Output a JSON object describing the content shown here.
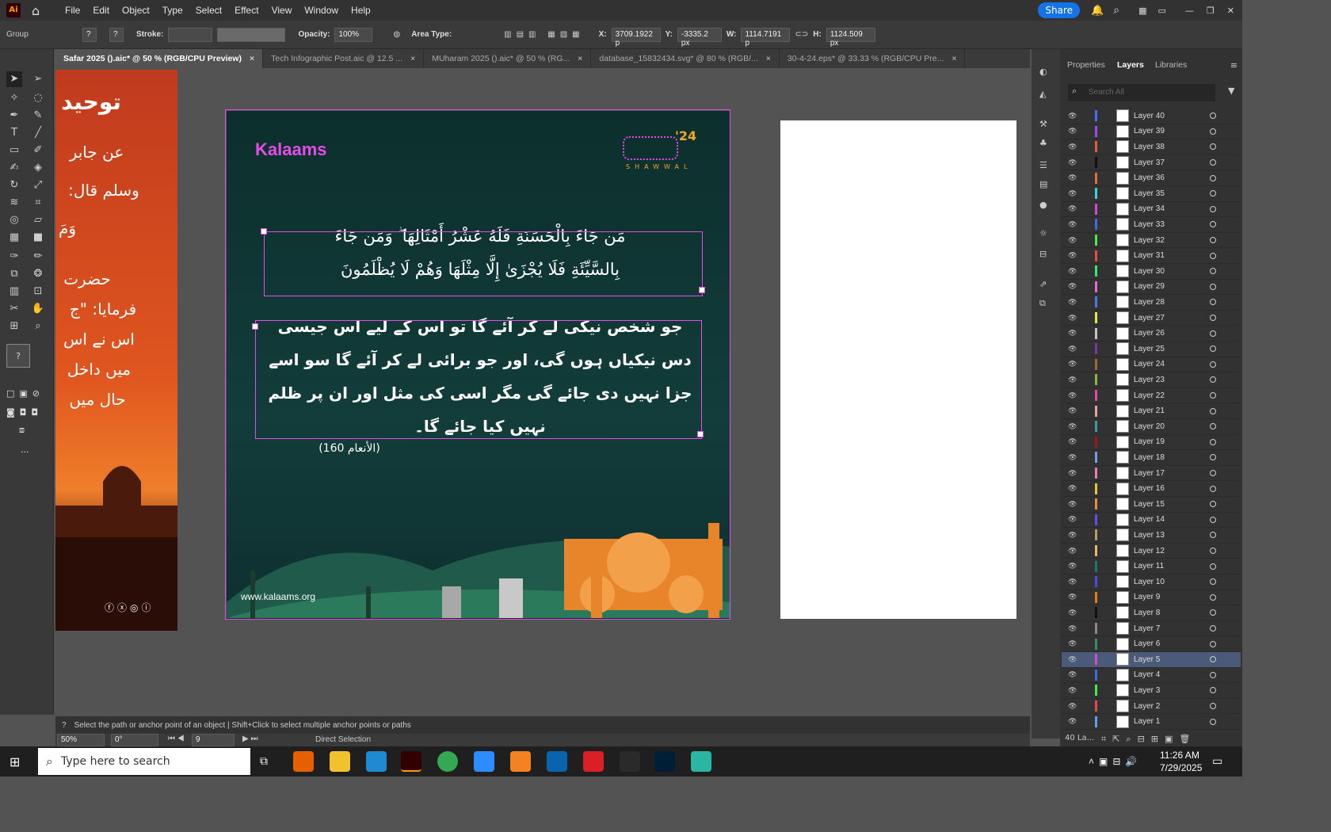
{
  "app": {
    "logo": "Ai",
    "share_label": "Share"
  },
  "menu": [
    "File",
    "Edit",
    "Object",
    "Type",
    "Select",
    "Effect",
    "View",
    "Window",
    "Help"
  ],
  "control": {
    "selection_label": "Group",
    "stroke_label": "Stroke:",
    "opacity_label": "Opacity:",
    "opacity_value": "100%",
    "area_type_label": "Area Type:",
    "x_label": "X:",
    "x_value": "3709.1922 p",
    "y_label": "Y:",
    "y_value": "-3335.2 px",
    "w_label": "W:",
    "w_value": "1114.7191 p",
    "h_label": "H:",
    "h_value": "1124.509 px"
  },
  "tabs": [
    {
      "label": "Safar 2025 ().aic* @ 50 % (RGB/CPU Preview)"
    },
    {
      "label": "Tech Infographic Post.aic @ 12.5 ..."
    },
    {
      "label": "MUharam 2025 ().aic* @ 50 % (RG..."
    },
    {
      "label": "database_15832434.svg* @ 80 % (RGB/..."
    },
    {
      "label": "30-4-24.eps* @ 33.33 % (RGB/CPU Pre..."
    }
  ],
  "artboard_left": {
    "heading": "توحید",
    "lines": [
      "عن جابر",
      "وسلم قال:",
      "وَمَ",
      "حضرت",
      "فرمایا: \"ج",
      "اس نے اس",
      "میں داخل",
      "حال میں"
    ]
  },
  "artboard_main": {
    "brand_logo": "Kalaams",
    "badge_year": "'24",
    "badge_text": "SHAWWAL",
    "verse_line1": "مَن جَاءَ بِالْحَسَنَةِ فَلَهُ عَشْرُ أَمْثَالِهَا ۖ وَمَن جَاءَ",
    "verse_line2": "بِالسَّيِّئَةِ فَلَا يُجْزَىٰ إِلَّا مِثْلَهَا وَهُمْ لَا يُظْلَمُونَ",
    "urdu_line1": "جو شخص نیکی لے کر آئے گا تو اس کے لیے اس جیسی",
    "urdu_line2": "دس نیکیاں ہوں گی، اور جو برائی لے کر آئے گا سو اسے",
    "urdu_line3": "جزا نہیں دی جائے گی مگر اسی کی مثل اور ان پر ظلم",
    "urdu_line4": "نہیں کیا جائے گا۔",
    "reference": "(الأنعام 160)",
    "website": "www.kalaams.org"
  },
  "panel": {
    "tabs": [
      "Properties",
      "Layers",
      "Libraries"
    ],
    "active_tab": "Layers",
    "search_placeholder": "Search All",
    "layer_count": "40 La...",
    "layers": [
      {
        "name": "Layer 40",
        "color": "#4a6cf7"
      },
      {
        "name": "Layer 39",
        "color": "#9b4af7"
      },
      {
        "name": "Layer 38",
        "color": "#e55a3c"
      },
      {
        "name": "Layer 37",
        "color": "#111111"
      },
      {
        "name": "Layer 36",
        "color": "#e86a3c"
      },
      {
        "name": "Layer 35",
        "color": "#3ccfe8"
      },
      {
        "name": "Layer 34",
        "color": "#d14ad1"
      },
      {
        "name": "Layer 33",
        "color": "#3c6ae8"
      },
      {
        "name": "Layer 32",
        "color": "#4ae84a"
      },
      {
        "name": "Layer 31",
        "color": "#e84a4a"
      },
      {
        "name": "Layer 30",
        "color": "#3ce86a"
      },
      {
        "name": "Layer 29",
        "color": "#e86ad1"
      },
      {
        "name": "Layer 28",
        "color": "#4a7ae8"
      },
      {
        "name": "Layer 27",
        "color": "#e8e84a"
      },
      {
        "name": "Layer 26",
        "color": "#c4c4c4"
      },
      {
        "name": "Layer 25",
        "color": "#7a3c9b"
      },
      {
        "name": "Layer 24",
        "color": "#9b6a3c"
      },
      {
        "name": "Layer 23",
        "color": "#8ab83c"
      },
      {
        "name": "Layer 22",
        "color": "#e84a9b"
      },
      {
        "name": "Layer 21",
        "color": "#e8a0a0"
      },
      {
        "name": "Layer 20",
        "color": "#3c9b9b"
      },
      {
        "name": "Layer 19",
        "color": "#9b1a1a"
      },
      {
        "name": "Layer 18",
        "color": "#7a9be8"
      },
      {
        "name": "Layer 17",
        "color": "#e87ab8"
      },
      {
        "name": "Layer 16",
        "color": "#e8c43c"
      },
      {
        "name": "Layer 15",
        "color": "#e8903c"
      },
      {
        "name": "Layer 14",
        "color": "#6a4ae8"
      },
      {
        "name": "Layer 13",
        "color": "#b89b6a"
      },
      {
        "name": "Layer 12",
        "color": "#e8b86a"
      },
      {
        "name": "Layer 11",
        "color": "#1a7a6a"
      },
      {
        "name": "Layer 10",
        "color": "#4a4ae8"
      },
      {
        "name": "Layer 9",
        "color": "#e87a1a"
      },
      {
        "name": "Layer 8",
        "color": "#111111"
      },
      {
        "name": "Layer 7",
        "color": "#888888"
      },
      {
        "name": "Layer 6",
        "color": "#3c8a6a"
      },
      {
        "name": "Layer 5",
        "color": "#d14ad1",
        "selected": true
      },
      {
        "name": "Layer 4",
        "color": "#3c6ae8"
      },
      {
        "name": "Layer 3",
        "color": "#4ae84a"
      },
      {
        "name": "Layer 2",
        "color": "#e84a4a"
      },
      {
        "name": "Layer 1",
        "color": "#6a9be8"
      }
    ]
  },
  "status": {
    "hint": "Select the path or anchor point of an object  |  Shift+Click to select multiple anchor points or paths",
    "zoom": "50%",
    "rotation": "0°",
    "artboard_number": "9",
    "tool_name": "Direct Selection"
  },
  "taskbar": {
    "search_placeholder": "Type here to search",
    "time": "11:26 AM",
    "date": "7/29/2025"
  }
}
